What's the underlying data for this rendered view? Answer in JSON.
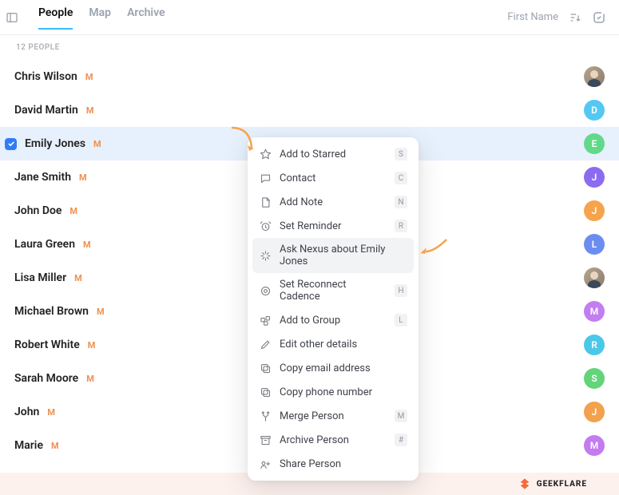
{
  "header": {
    "tabs": [
      {
        "label": "People",
        "active": true
      },
      {
        "label": "Map",
        "active": false
      },
      {
        "label": "Archive",
        "active": false
      }
    ],
    "sort_label": "First Name"
  },
  "count_label": "12 PEOPLE",
  "people": [
    {
      "name": "Chris Wilson",
      "marker": "M",
      "avatar_type": "photo",
      "avatar_initial": "",
      "avatar_bg": ""
    },
    {
      "name": "David Martin",
      "marker": "M",
      "avatar_type": "initial",
      "avatar_initial": "D",
      "avatar_bg": "#53c9f2"
    },
    {
      "name": "Emily Jones",
      "marker": "M",
      "avatar_type": "initial",
      "avatar_initial": "E",
      "avatar_bg": "#62d98a"
    },
    {
      "name": "Jane Smith",
      "marker": "M",
      "avatar_type": "initial",
      "avatar_initial": "J",
      "avatar_bg": "#8b6cf0"
    },
    {
      "name": "John Doe",
      "marker": "M",
      "avatar_type": "initial",
      "avatar_initial": "J",
      "avatar_bg": "#f5a44d"
    },
    {
      "name": "Laura Green",
      "marker": "M",
      "avatar_type": "initial",
      "avatar_initial": "L",
      "avatar_bg": "#6c8df0"
    },
    {
      "name": "Lisa Miller",
      "marker": "M",
      "avatar_type": "photo",
      "avatar_initial": "",
      "avatar_bg": ""
    },
    {
      "name": "Michael Brown",
      "marker": "M",
      "avatar_type": "initial",
      "avatar_initial": "M",
      "avatar_bg": "#c27ef0"
    },
    {
      "name": "Robert White",
      "marker": "M",
      "avatar_type": "initial",
      "avatar_initial": "R",
      "avatar_bg": "#4bc7e8"
    },
    {
      "name": "Sarah Moore",
      "marker": "M",
      "avatar_type": "initial",
      "avatar_initial": "S",
      "avatar_bg": "#63d47a"
    },
    {
      "name": "John",
      "marker": "M",
      "avatar_type": "initial",
      "avatar_initial": "J",
      "avatar_bg": "#f2a14e"
    },
    {
      "name": "Marie",
      "marker": "M",
      "avatar_type": "initial",
      "avatar_initial": "M",
      "avatar_bg": "#c47af0"
    }
  ],
  "selected_index": 2,
  "context_menu": {
    "highlight_index": 4,
    "items": [
      {
        "icon": "star",
        "label": "Add to Starred",
        "key": "S"
      },
      {
        "icon": "chat",
        "label": "Contact",
        "key": "C"
      },
      {
        "icon": "note",
        "label": "Add Note",
        "key": "N"
      },
      {
        "icon": "alarm",
        "label": "Set Reminder",
        "key": "R"
      },
      {
        "icon": "sparkle",
        "label": "Ask Nexus about Emily Jones",
        "key": ""
      },
      {
        "icon": "target",
        "label": "Set Reconnect Cadence",
        "key": "H"
      },
      {
        "icon": "group",
        "label": "Add to Group",
        "key": "L"
      },
      {
        "icon": "pencil",
        "label": "Edit other details",
        "key": ""
      },
      {
        "icon": "copy",
        "label": "Copy email address",
        "key": ""
      },
      {
        "icon": "copy",
        "label": "Copy phone number",
        "key": ""
      },
      {
        "icon": "merge",
        "label": "Merge Person",
        "key": "M"
      },
      {
        "icon": "archive",
        "label": "Archive Person",
        "key": "#"
      },
      {
        "icon": "share",
        "label": "Share Person",
        "key": ""
      }
    ]
  },
  "footer": {
    "brand": "GEEKFLARE"
  }
}
